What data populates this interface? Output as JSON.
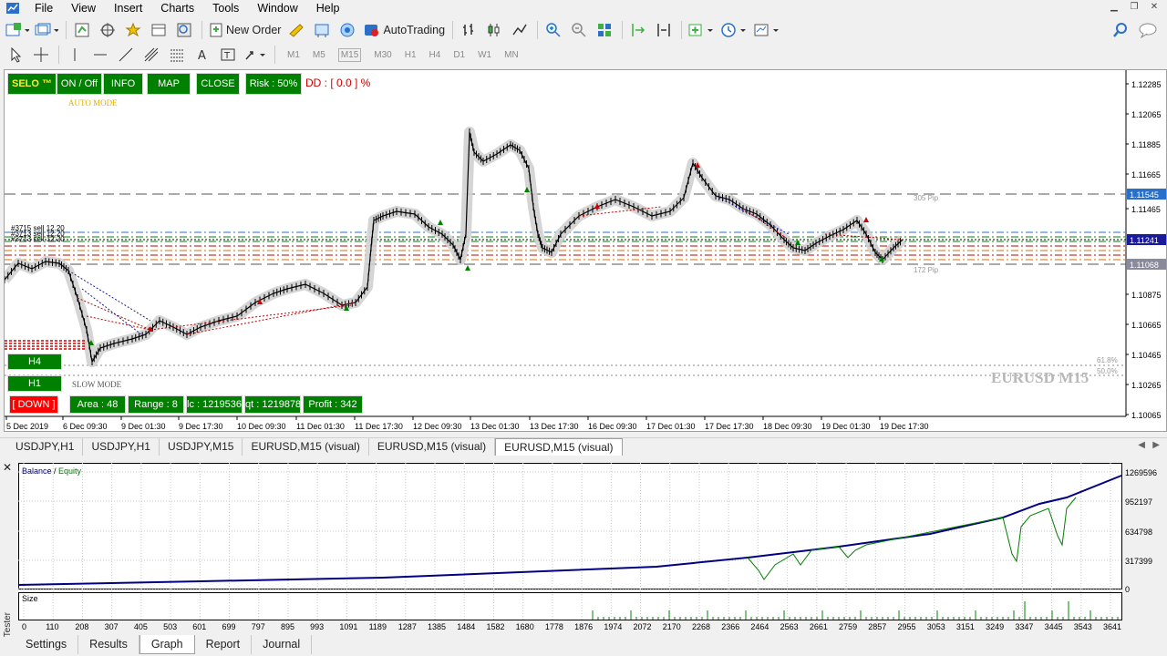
{
  "menu": [
    "File",
    "View",
    "Insert",
    "Charts",
    "Tools",
    "Window",
    "Help"
  ],
  "toolbar": {
    "new_order": "New Order",
    "autotrading": "AutoTrading",
    "timeframes": [
      "M1",
      "M5",
      "M15",
      "M30",
      "H1",
      "H4",
      "D1",
      "W1",
      "MN"
    ]
  },
  "chart": {
    "symbol_label": "EURUSD M15",
    "buttons": {
      "selo": "SELO ™",
      "onoff": "ON / Off",
      "info": "INFO",
      "map": "MAP",
      "close": "CLOSE",
      "risk": "Risk : 50%"
    },
    "dd": "DD : [ 0.0 ] %",
    "auto_mode": "AUTO MODE",
    "slow_mode": "SLOW MODE",
    "h4": "H4",
    "h1": "H1",
    "status": {
      "down": "[ DOWN ]",
      "area": "Area : 48",
      "range": "Range : 8",
      "lc": "lc : 1219536",
      "qt": "qt : 1219878",
      "profit": "Profit : 342"
    },
    "price_axis": [
      "1.12285",
      "1.12065",
      "1.11885",
      "1.11665",
      "1.11545",
      "1.11465",
      "1.11241",
      "1.11068",
      "1.10875",
      "1.10665",
      "1.10465",
      "1.10265",
      "1.10065"
    ],
    "time_axis": [
      "5 Dec 2019",
      "6 Dec 09:30",
      "9 Dec 01:30",
      "9 Dec 17:30",
      "10 Dec 09:30",
      "11 Dec 01:30",
      "11 Dec 17:30",
      "12 Dec 09:30",
      "13 Dec 01:30",
      "13 Dec 17:30",
      "16 Dec 09:30",
      "17 Dec 01:30",
      "17 Dec 17:30",
      "18 Dec 09:30",
      "19 Dec 01:30",
      "19 Dec 17:30"
    ],
    "line_labels": [
      "305 Pip",
      "172 Pip",
      "61.8%",
      "50.0%"
    ],
    "order_labels": [
      "#3715 sell 12.20",
      "#3713 sell 12.20",
      "#3713 sell 12.20"
    ]
  },
  "symbol_tabs": [
    "USDJPY,H1",
    "USDJPY,H1",
    "USDJPY,M15",
    "EURUSD,M15 (visual)",
    "EURUSD,M15 (visual)",
    "EURUSD,M15 (visual)"
  ],
  "tester": {
    "label": "Tester",
    "legend_balance": "Balance",
    "legend_sep": " / ",
    "legend_equity": "Equity",
    "size_label": "Size",
    "y_ticks": [
      "1269596",
      "952197",
      "634798",
      "317399",
      "0"
    ],
    "x_ticks": [
      "0",
      "110",
      "208",
      "307",
      "405",
      "503",
      "601",
      "699",
      "797",
      "895",
      "993",
      "1091",
      "1189",
      "1287",
      "1385",
      "1484",
      "1582",
      "1680",
      "1778",
      "1876",
      "1974",
      "2072",
      "2170",
      "2268",
      "2366",
      "2464",
      "2563",
      "2661",
      "2759",
      "2857",
      "2955",
      "3053",
      "3151",
      "3249",
      "3347",
      "3445",
      "3543",
      "3641"
    ]
  },
  "bottom_tabs": [
    "Settings",
    "Results",
    "Graph",
    "Report",
    "Journal"
  ],
  "colors": {
    "buy": "#008000",
    "down": "#ff0000",
    "balance": "#000080",
    "equity": "#008000",
    "grid": "#c0c0c0"
  }
}
